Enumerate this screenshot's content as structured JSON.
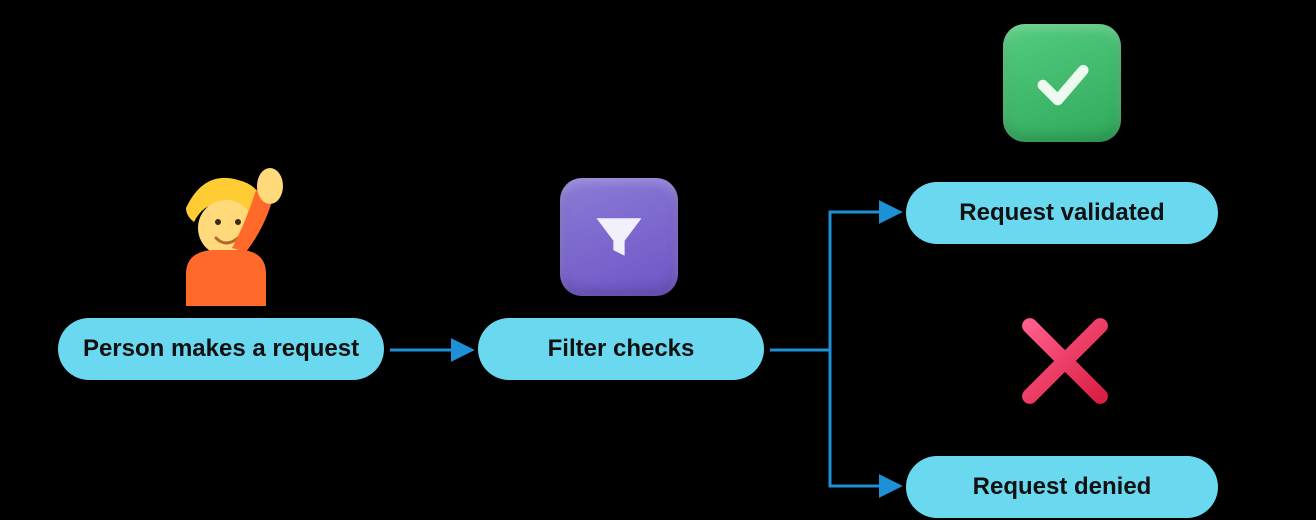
{
  "steps": {
    "request": {
      "label": "Person makes a request",
      "icon": "person-raising-hand"
    },
    "filter": {
      "label": "Filter checks",
      "icon": "filter"
    },
    "validated": {
      "label": "Request validated",
      "icon": "check"
    },
    "denied": {
      "label": "Request denied",
      "icon": "cross"
    }
  },
  "flow": [
    {
      "from": "request",
      "to": "filter"
    },
    {
      "from": "filter",
      "to": "validated"
    },
    {
      "from": "filter",
      "to": "denied"
    }
  ],
  "colors": {
    "pill": "#6ad9f0",
    "arrow": "#1e90d6",
    "filterTile": "#6e55c6",
    "checkTile": "#2fa95b",
    "crossGlyph": "#e03055"
  }
}
